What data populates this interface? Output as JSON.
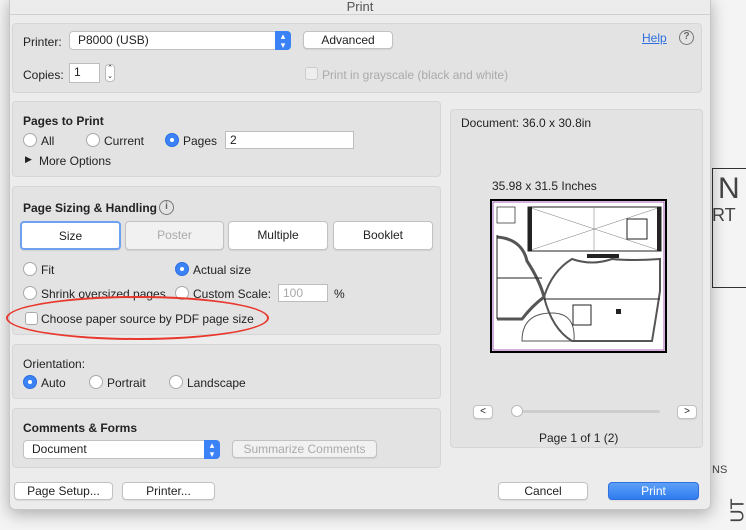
{
  "window": {
    "title": "Print"
  },
  "printer": {
    "label": "Printer:",
    "value": "P8000 (USB)",
    "advanced": "Advanced",
    "help": "Help",
    "help_icon": "?"
  },
  "copies": {
    "label": "Copies:",
    "value": "1",
    "grayscale": "Print in grayscale (black and white)"
  },
  "pages": {
    "title": "Pages to Print",
    "all": "All",
    "current": "Current",
    "pages": "Pages",
    "pages_value": "2",
    "more": "More Options",
    "selected": "Pages"
  },
  "sizing": {
    "title": "Page Sizing & Handling",
    "info_icon": "i",
    "tabs": [
      "Size",
      "Poster",
      "Multiple",
      "Booklet"
    ],
    "fit": "Fit",
    "actual": "Actual size",
    "shrink": "Shrink oversized pages",
    "custom": "Custom Scale:",
    "custom_value": "100",
    "percent": "%",
    "paper_source": "Choose paper source by PDF page size",
    "selected": "Actual size"
  },
  "orientation": {
    "title": "Orientation:",
    "auto": "Auto",
    "portrait": "Portrait",
    "landscape": "Landscape",
    "selected": "Auto"
  },
  "comments": {
    "title": "Comments & Forms",
    "value": "Document",
    "summarize": "Summarize Comments"
  },
  "preview": {
    "document": "Document: 36.0 x 30.8in",
    "size": "35.98 x 31.5 Inches",
    "prev": "<",
    "next": ">",
    "page": "Page 1 of 1 (2)"
  },
  "footer": {
    "page_setup": "Page Setup...",
    "printer": "Printer...",
    "cancel": "Cancel",
    "print": "Print"
  },
  "colors": {
    "accent": "#3b82f6",
    "annotation": "#e8372c"
  }
}
